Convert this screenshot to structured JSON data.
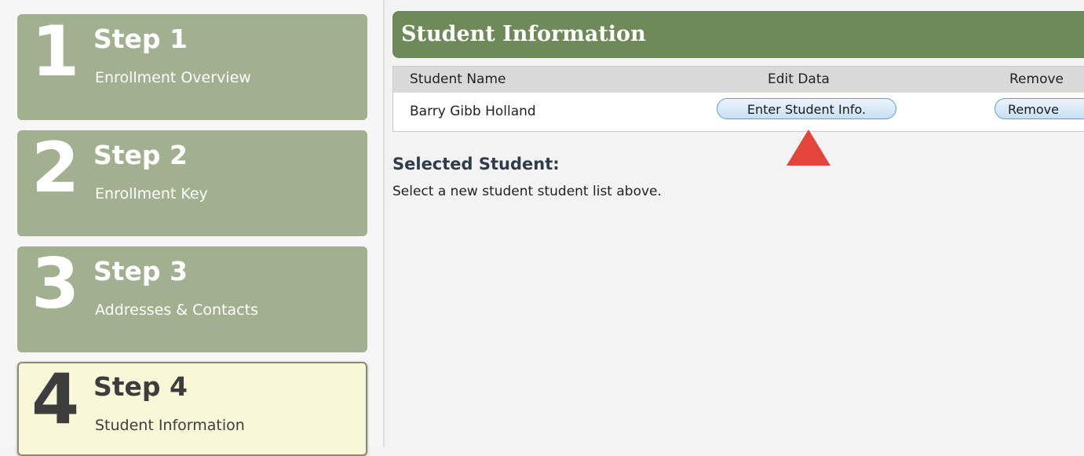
{
  "steps": [
    {
      "number": "1",
      "title": "Step 1",
      "subtitle": "Enrollment Overview"
    },
    {
      "number": "2",
      "title": "Step 2",
      "subtitle": "Enrollment Key"
    },
    {
      "number": "3",
      "title": "Step 3",
      "subtitle": "Addresses & Contacts"
    },
    {
      "number": "4",
      "title": "Step 4",
      "subtitle": "Student Information"
    }
  ],
  "active_step": "4",
  "panel": {
    "title": "Student Information",
    "columns": [
      "Student Name",
      "Edit Data",
      "Remove"
    ],
    "rows": [
      {
        "student_name": "Barry Gibb Holland",
        "edit_button": "Enter Student Info.",
        "remove_button": "Remove"
      }
    ]
  },
  "selected": {
    "title": "Selected Student:",
    "message": "Select a new student student list above."
  },
  "colors": {
    "step_bg": "#a1b08e",
    "active_step_bg": "#f8f7d8",
    "header_bg": "#6d8a58",
    "arrow": "#e5443a"
  }
}
